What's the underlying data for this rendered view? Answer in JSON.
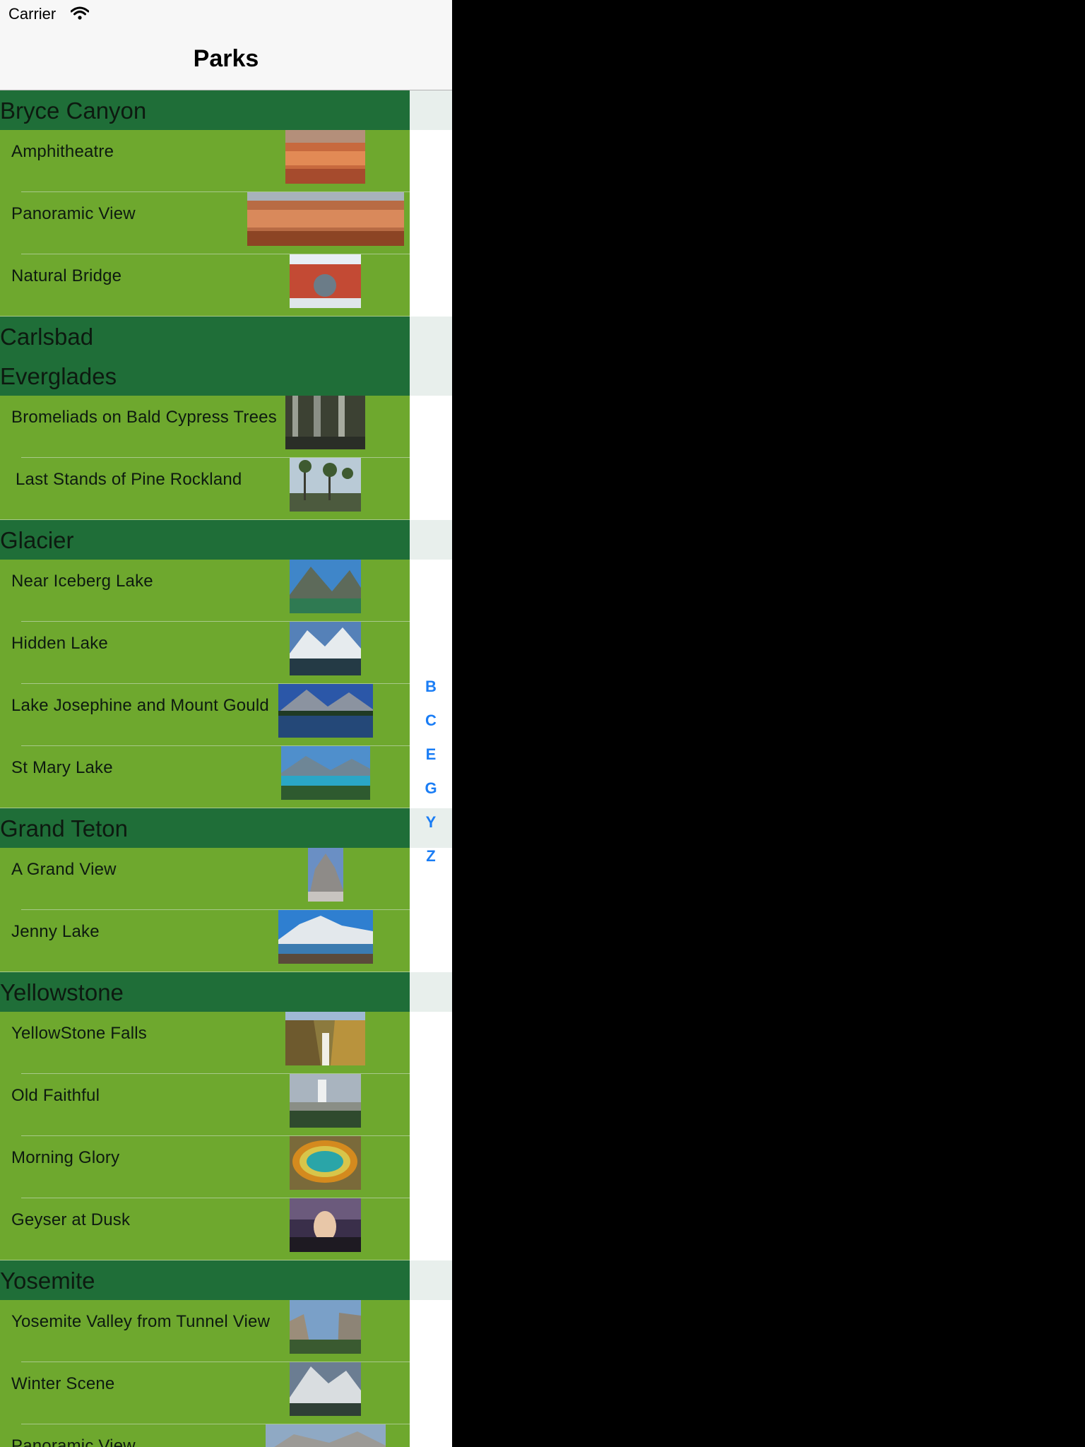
{
  "status_bar": {
    "carrier": "Carrier"
  },
  "nav": {
    "title": "Parks"
  },
  "sections": [
    {
      "name": "Bryce Canyon",
      "rows": [
        "Amphitheatre",
        "Panoramic View",
        "Natural Bridge"
      ]
    },
    {
      "name": "Carlsbad",
      "rows": []
    },
    {
      "name": "Everglades",
      "rows": [
        "Bromeliads on Bald Cypress Trees",
        "Last Stands of Pine Rockland"
      ]
    },
    {
      "name": "Glacier",
      "rows": [
        "Near Iceberg Lake",
        "Hidden Lake",
        "Lake Josephine and Mount Gould",
        "St Mary Lake"
      ]
    },
    {
      "name": "Grand Teton",
      "rows": [
        "A Grand View",
        "Jenny Lake"
      ]
    },
    {
      "name": "Yellowstone",
      "rows": [
        "YellowStone Falls",
        "Old Faithful",
        "Morning Glory",
        "Geyser at Dusk"
      ]
    },
    {
      "name": "Yosemite",
      "rows": [
        "Yosemite Valley from Tunnel View",
        "Winter Scene",
        "Panoramic View"
      ]
    }
  ],
  "index": [
    "B",
    "C",
    "E",
    "G",
    "Y",
    "Z"
  ],
  "colors": {
    "section_header_bg": "#1f6e38",
    "row_bg": "#6ea82e",
    "index_color": "#1a7df5"
  }
}
